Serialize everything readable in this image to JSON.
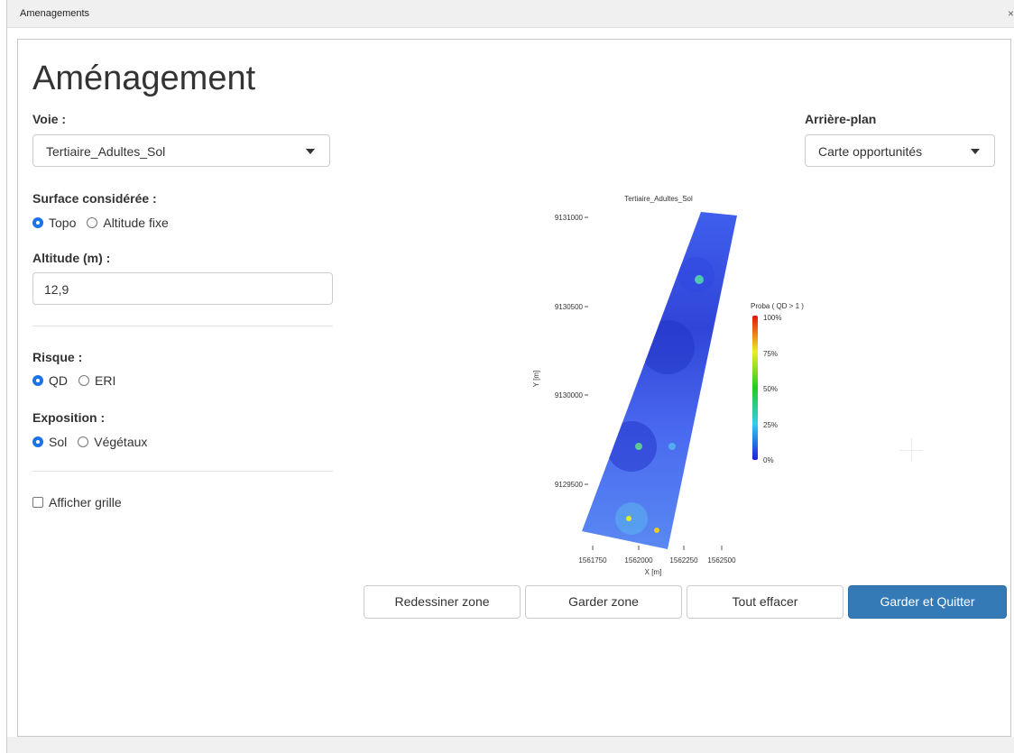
{
  "window": {
    "title": "Amenagements",
    "close_glyph": "×"
  },
  "page": {
    "heading": "Aménagement"
  },
  "voie": {
    "label": "Voie :",
    "selected": "Tertiaire_Adultes_Sol"
  },
  "background": {
    "label": "Arrière-plan",
    "selected": "Carte opportunités"
  },
  "surface": {
    "label": "Surface considérée :",
    "options": [
      {
        "label": "Topo",
        "checked": true
      },
      {
        "label": "Altitude fixe",
        "checked": false
      }
    ]
  },
  "altitude": {
    "label": "Altitude (m) :",
    "value": "12,9"
  },
  "risque": {
    "label": "Risque :",
    "options": [
      {
        "label": "QD",
        "checked": true
      },
      {
        "label": "ERI",
        "checked": false
      }
    ]
  },
  "exposition": {
    "label": "Exposition :",
    "options": [
      {
        "label": "Sol",
        "checked": true
      },
      {
        "label": "Végétaux",
        "checked": false
      }
    ]
  },
  "grid_toggle": {
    "label": "Afficher grille",
    "checked": false
  },
  "buttons": {
    "redraw": "Redessiner zone",
    "keep": "Garder zone",
    "clear": "Tout effacer",
    "save_quit": "Garder et Quitter"
  },
  "colors": {
    "primary": "#337ab7",
    "radio": "#1a73e8"
  },
  "map": {
    "title": "Tertiaire_Adultes_Sol",
    "x_label": "X [m]",
    "y_label": "Y [m]",
    "x_ticks": [
      "1561750",
      "1562000",
      "1562250",
      "1562500"
    ],
    "y_ticks": [
      "9131000",
      "9130500",
      "9130000",
      "9129500"
    ],
    "legend_title": "Proba ( QD > 1 )",
    "legend_ticks": [
      "100%",
      "75%",
      "50%",
      "25%",
      "0%"
    ]
  }
}
